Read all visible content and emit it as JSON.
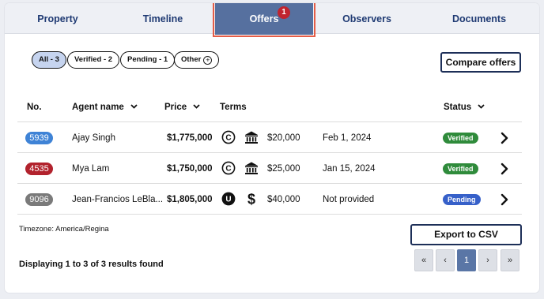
{
  "tabs": [
    {
      "label": "Property"
    },
    {
      "label": "Timeline"
    },
    {
      "label": "Offers",
      "badge": "1",
      "active": true
    },
    {
      "label": "Observers"
    },
    {
      "label": "Documents"
    }
  ],
  "filters": {
    "all": "All - 3",
    "verified": "Verified - 2",
    "pending": "Pending - 1",
    "other": "Other"
  },
  "compare_button": "Compare offers",
  "columns": {
    "no": "No.",
    "agent": "Agent name",
    "price": "Price",
    "terms": "Terms",
    "status": "Status"
  },
  "rows": [
    {
      "no": "5939",
      "no_color": "#3f83d6",
      "agent": "Ajay Singh",
      "price": "$1,775,000",
      "term_icon": "c",
      "finance_icon": "bank",
      "deposit": "$20,000",
      "date": "Feb 1, 2024",
      "status": "Verified",
      "status_color": "#2f8b3b"
    },
    {
      "no": "4535",
      "no_color": "#b2222d",
      "agent": "Mya Lam",
      "price": "$1,750,000",
      "term_icon": "c",
      "finance_icon": "bank",
      "deposit": "$25,000",
      "date": "Jan 15, 2024",
      "status": "Verified",
      "status_color": "#2f8b3b"
    },
    {
      "no": "9096",
      "no_color": "#7a7a7a",
      "agent": "Jean-Francios LeBla...",
      "price": "$1,805,000",
      "term_icon": "u",
      "finance_icon": "dollar",
      "deposit": "$40,000",
      "date": "Not provided",
      "status": "Pending",
      "status_color": "#3660c9"
    }
  ],
  "timezone": "Timezone: America/Regina",
  "export_button": "Export to CSV",
  "summary": "Displaying 1 to 3 of 3 results found",
  "pagination": {
    "first": "«",
    "prev": "‹",
    "current": "1",
    "next": "›",
    "last": "»"
  }
}
